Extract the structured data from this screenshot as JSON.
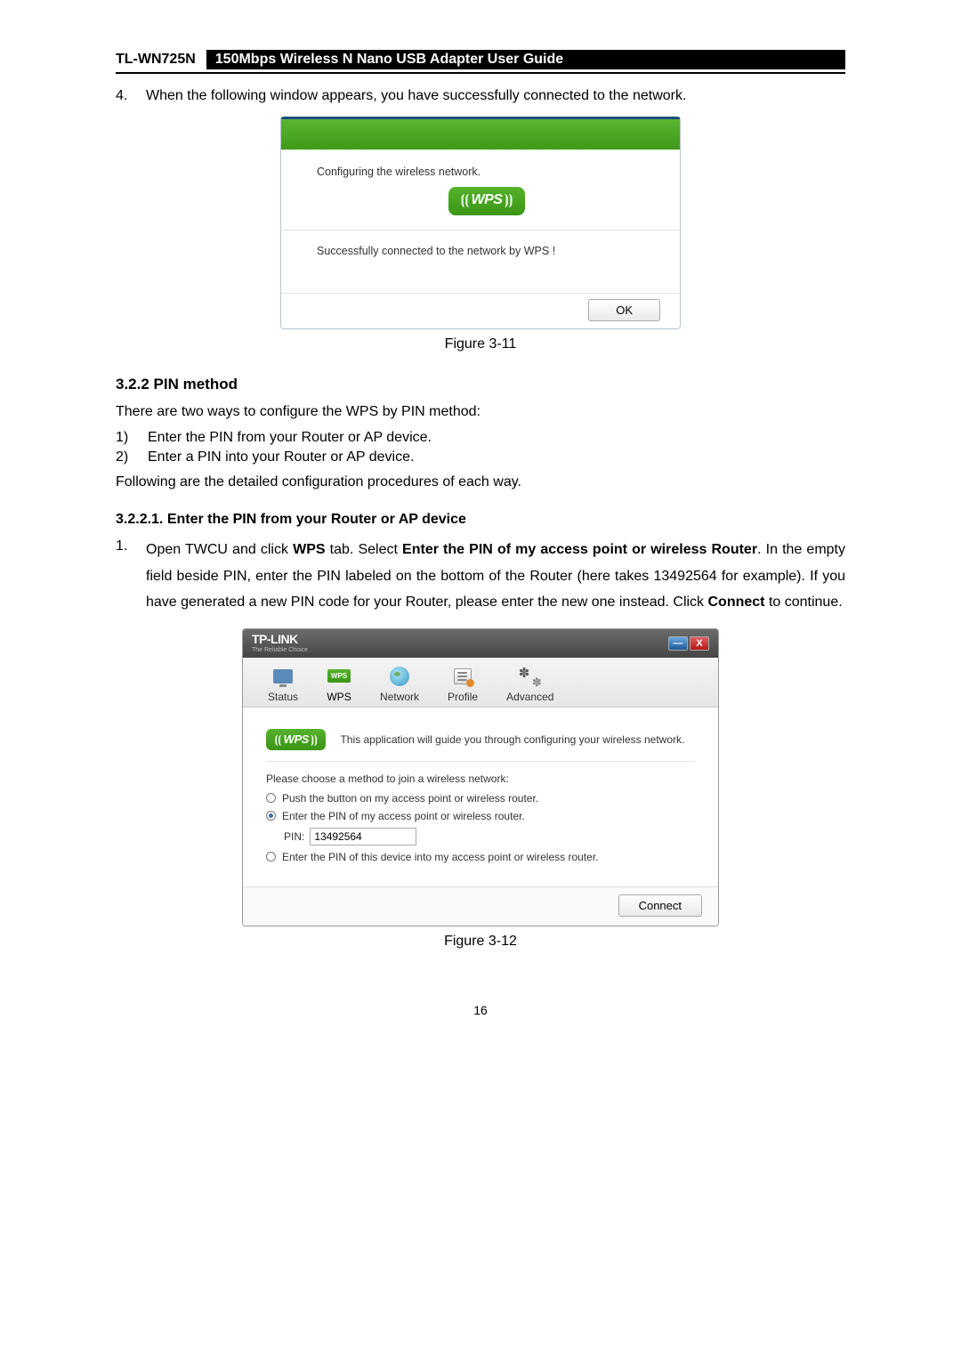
{
  "header": {
    "model": "TL-WN725N",
    "title": "150Mbps Wireless N Nano USB Adapter User Guide"
  },
  "step4": {
    "num": "4.",
    "text": "When the following window appears, you have successfully connected to the network."
  },
  "dialogA": {
    "configuring": "Configuring the wireless network.",
    "wps_label": "WPS",
    "success": "Successfully connected to the network by WPS !",
    "ok": "OK"
  },
  "fig11": "Figure 3-11",
  "sec322": "3.2.2  PIN method",
  "p_intro": "There are two ways to configure the WPS by PIN method:",
  "list": {
    "i1_n": "1)",
    "i1_t": "Enter the PIN from your Router or AP device.",
    "i2_n": "2)",
    "i2_t": "Enter a PIN into your Router or AP device."
  },
  "p_follow": "Following are the detailed configuration procedures of each way.",
  "sec3221": "3.2.2.1.  Enter the PIN from your Router or AP device",
  "step1": {
    "num": "1.",
    "pre": "Open TWCU and click ",
    "b1": "WPS",
    "mid1": " tab. Select ",
    "b2": "Enter the PIN of my access point or wireless Router",
    "mid2": ". In the empty field beside PIN, enter the PIN labeled on the bottom of the Router (here takes 13492564 for example). If you have generated a new PIN code for your Router, please enter the new one instead. Click ",
    "b3": "Connect",
    "post": " to continue."
  },
  "twcu": {
    "logo": "TP-LINK",
    "tagline": "The Reliable Choice",
    "min": "—",
    "close": "X",
    "tabs": {
      "status": "Status",
      "wps": "WPS",
      "network": "Network",
      "profile": "Profile",
      "advanced": "Advanced"
    },
    "wps_badge": "WPS",
    "intro": "This application will guide you through configuring your wireless network.",
    "choose": "Please choose a method to join a wireless network:",
    "opt1": "Push the button on my access point or wireless router.",
    "opt2": "Enter the PIN of my access point or wireless router.",
    "pin_label": "PIN:",
    "pin_value": "13492564",
    "opt3": "Enter the PIN of this device into my access point or wireless router.",
    "connect": "Connect"
  },
  "fig12": "Figure 3-12",
  "page_num": "16"
}
